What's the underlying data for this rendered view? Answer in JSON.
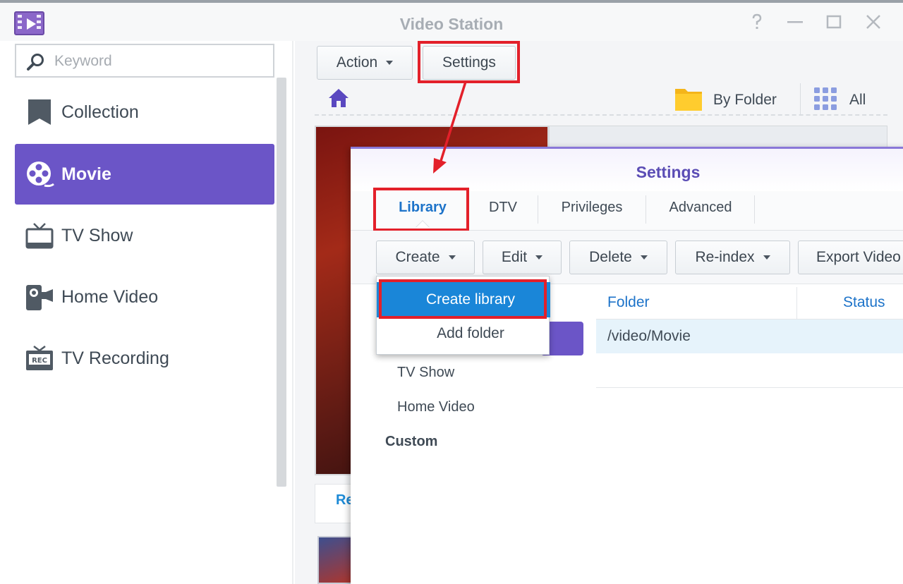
{
  "window": {
    "title": "Video Station",
    "controls": [
      "help-icon",
      "minimize-icon",
      "maximize-icon",
      "close-icon"
    ]
  },
  "sidebar": {
    "search_placeholder": "Keyword",
    "items": [
      {
        "label": "Collection",
        "icon": "bookmark-icon"
      },
      {
        "label": "Movie",
        "icon": "film-reel-icon",
        "active": true
      },
      {
        "label": "TV Show",
        "icon": "tv-icon"
      },
      {
        "label": "Home Video",
        "icon": "camcorder-icon"
      },
      {
        "label": "TV Recording",
        "icon": "rec-tv-icon"
      }
    ]
  },
  "toolbar": {
    "action_label": "Action",
    "settings_label": "Settings",
    "view_folder_label": "By Folder",
    "view_all_label": "All"
  },
  "main": {
    "partial_link": "Re"
  },
  "dialog": {
    "title": "Settings",
    "tabs": [
      "Library",
      "DTV",
      "Privileges",
      "Advanced"
    ],
    "buttons": {
      "create": "Create",
      "edit": "Edit",
      "delete": "Delete",
      "reindex": "Re-index",
      "export": "Export Video"
    },
    "dropdown": [
      "Create library",
      "Add folder"
    ],
    "libraries": [
      "TV Show",
      "Home Video"
    ],
    "custom_group": "Custom",
    "table": {
      "headers": [
        "Folder",
        "Status"
      ],
      "rows": [
        {
          "folder": "/video/Movie",
          "status": ""
        }
      ]
    }
  },
  "colors": {
    "accent": "#6b55c7",
    "highlight": "#1a86d8",
    "annotation": "#e3202a",
    "link": "#1d73c9"
  }
}
